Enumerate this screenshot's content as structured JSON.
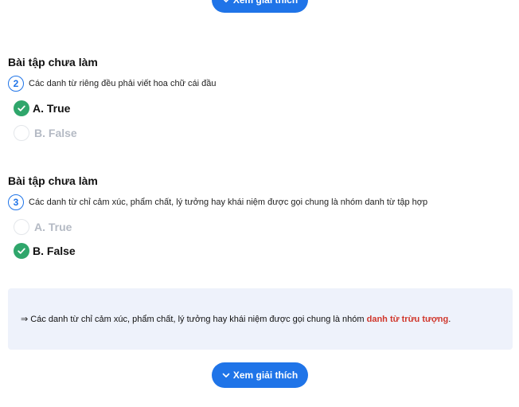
{
  "explain_button_label": "Xem giải thích",
  "questions": [
    {
      "section_title": "Bài tập chưa làm",
      "number": "2",
      "text": "Các danh từ riêng đều phải viết hoa chữ cái đầu",
      "options": [
        {
          "label": "A. True",
          "selected": true
        },
        {
          "label": "B. False",
          "selected": false
        }
      ]
    },
    {
      "section_title": "Bài tập chưa làm",
      "number": "3",
      "text": "Các danh từ chỉ cảm xúc, phẩm chất, lý tưởng hay khái niệm được gọi chung là nhóm danh từ tập hợp",
      "options": [
        {
          "label": "A. True",
          "selected": false
        },
        {
          "label": "B. False",
          "selected": true
        }
      ]
    }
  ],
  "explanation": {
    "arrow": "⇒",
    "prefix": "Các danh từ chỉ cảm xúc, phẩm chất, lý tưởng hay khái niệm được gọi chung là nhóm",
    "highlight": "danh từ trừu tượng",
    "suffix": "."
  },
  "colors": {
    "accent": "#1f74e8",
    "check": "#2fa66b",
    "highlight": "#d0362b",
    "note_bg": "#eef2fb"
  }
}
